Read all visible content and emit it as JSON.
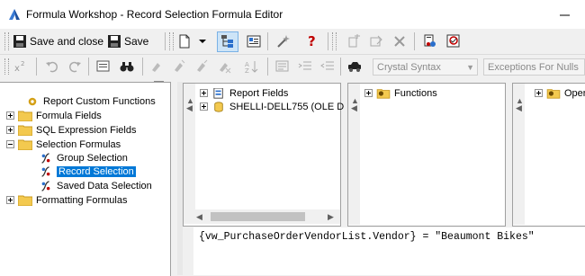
{
  "window": {
    "title": "Formula Workshop - Record Selection Formula Editor"
  },
  "toolbar1": {
    "save_close_label": "Save and close",
    "save_label": "Save"
  },
  "toolbar2": {
    "syntax_value": "Crystal Syntax",
    "exceptions_value": "Exceptions For Nulls"
  },
  "tree": {
    "items": [
      {
        "label": "Report Custom Functions"
      },
      {
        "label": "Formula Fields"
      },
      {
        "label": "SQL Expression Fields"
      },
      {
        "label": "Selection Formulas"
      },
      {
        "label": "Group Selection"
      },
      {
        "label": "Record Selection"
      },
      {
        "label": "Saved Data Selection"
      },
      {
        "label": "Formatting Formulas"
      }
    ]
  },
  "fields_pane": {
    "items": [
      {
        "label": "Report Fields"
      },
      {
        "label": "SHELLI-DELL755 (OLE D"
      }
    ]
  },
  "functions_pane": {
    "items": [
      {
        "label": "Functions"
      }
    ]
  },
  "operators_pane": {
    "items": [
      {
        "label": "Opera"
      }
    ]
  },
  "editor": {
    "formula_text": "{vw_PurchaseOrderVendorList.Vendor} = \"Beaumont Bikes\""
  }
}
